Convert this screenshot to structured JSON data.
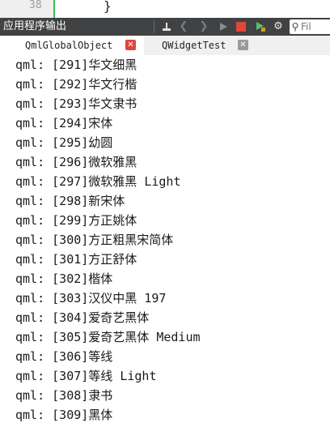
{
  "editor": {
    "line_number": "38",
    "brace": "}"
  },
  "toolbar": {
    "title": "应用程序输出",
    "filter_placeholder": "Fil"
  },
  "tabs": [
    {
      "label": "QmlGlobalObject",
      "active": true
    },
    {
      "label": "QWidgetTest",
      "active": false
    }
  ],
  "output_lines": [
    "qml: [291]华文细黑",
    "qml: [292]华文行楷",
    "qml: [293]华文隶书",
    "qml: [294]宋体",
    "qml: [295]幼圆",
    "qml: [296]微软雅黑",
    "qml: [297]微软雅黑 Light",
    "qml: [298]新宋体",
    "qml: [299]方正姚体",
    "qml: [300]方正粗黑宋简体",
    "qml: [301]方正舒体",
    "qml: [302]楷体",
    "qml: [303]汉仪中黑 197",
    "qml: [304]爱奇艺黑体",
    "qml: [305]爱奇艺黑体 Medium",
    "qml: [306]等线",
    "qml: [307]等线 Light",
    "qml: [308]隶书",
    "qml: [309]黑体"
  ],
  "colors": {
    "toolbar_bg": "#404244",
    "stop_icon": "#e2453a",
    "gutter_marker": "#2fbf4f"
  }
}
